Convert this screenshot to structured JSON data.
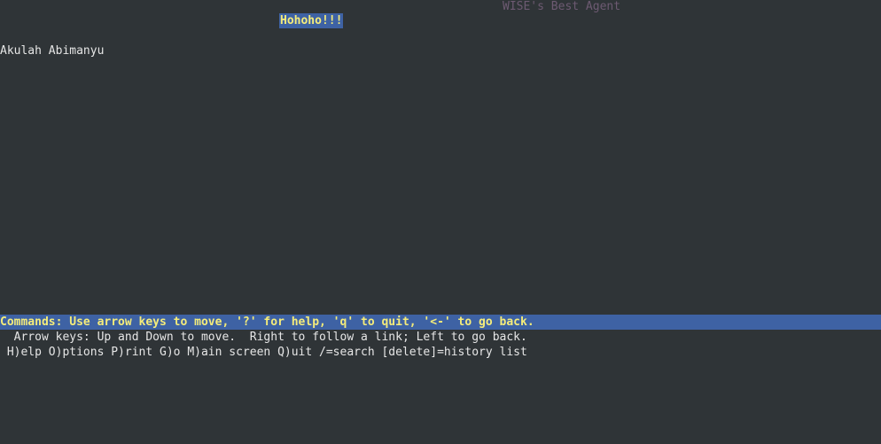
{
  "page": {
    "title": "WISE's Best Agent",
    "link_text": "Hohoho!!!",
    "body_text": "Akulah Abimanyu"
  },
  "status_bar": {
    "text": "Commands: Use arrow keys to move, '?' for help, 'q' to quit, '<-' to go back."
  },
  "help": {
    "line1": "  Arrow keys: Up and Down to move.  Right to follow a link; Left to go back.",
    "line2": " H)elp O)ptions P)rint G)o M)ain screen Q)uit /=search [delete]=history list"
  },
  "colors": {
    "background": "#2f3437",
    "highlight_bg": "#3e62a4",
    "highlight_fg": "#f5ec7a",
    "title_fg": "#6d5a72",
    "text_fg": "#e6e6e6"
  }
}
